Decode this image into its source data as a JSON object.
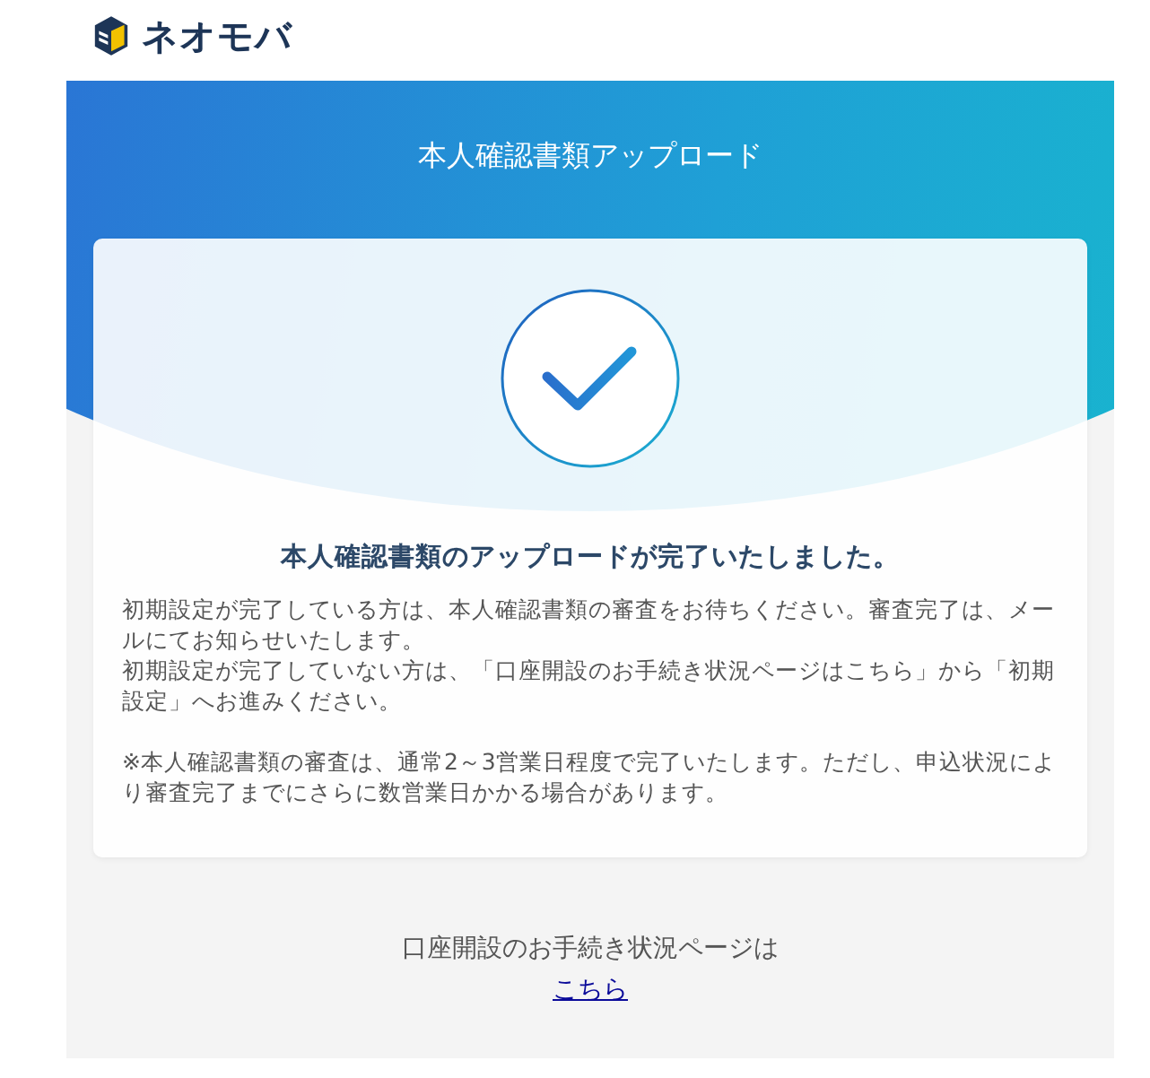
{
  "logo": {
    "text": "ネオモバ"
  },
  "header": {
    "title": "本人確認書類アップロード"
  },
  "card": {
    "heading": "本人確認書類のアップロードが完了いたしました。",
    "paragraphs": [
      "初期設定が完了している方は、本人確認書類の審査をお待ちください。審査完了は、メールにてお知らせいたします。",
      "初期設定が完了していない方は、「口座開設のお手続き状況ページはこちら」から「初期設定」へお進みください。"
    ],
    "note": "※本人確認書類の審査は、通常2～3営業日程度で完了いたします。ただし、申込状況により審査完了までにさらに数営業日かかる場合があります。"
  },
  "footer": {
    "text": "口座開設のお手続き状況ページは",
    "link": "こちら"
  }
}
